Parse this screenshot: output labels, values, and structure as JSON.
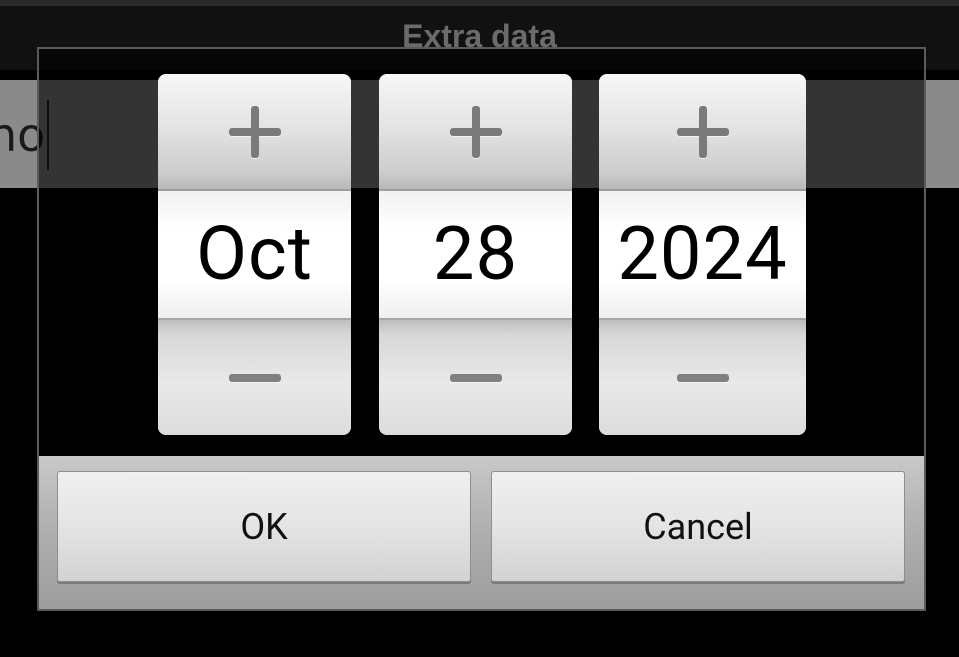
{
  "app": {
    "title": "Extra data",
    "field_text": "ho"
  },
  "picker": {
    "month": "Oct",
    "day": "28",
    "year": "2024"
  },
  "buttons": {
    "ok_label": "OK",
    "cancel_label": "Cancel"
  },
  "icons": {
    "increment": "plus-icon",
    "decrement": "minus-icon"
  }
}
